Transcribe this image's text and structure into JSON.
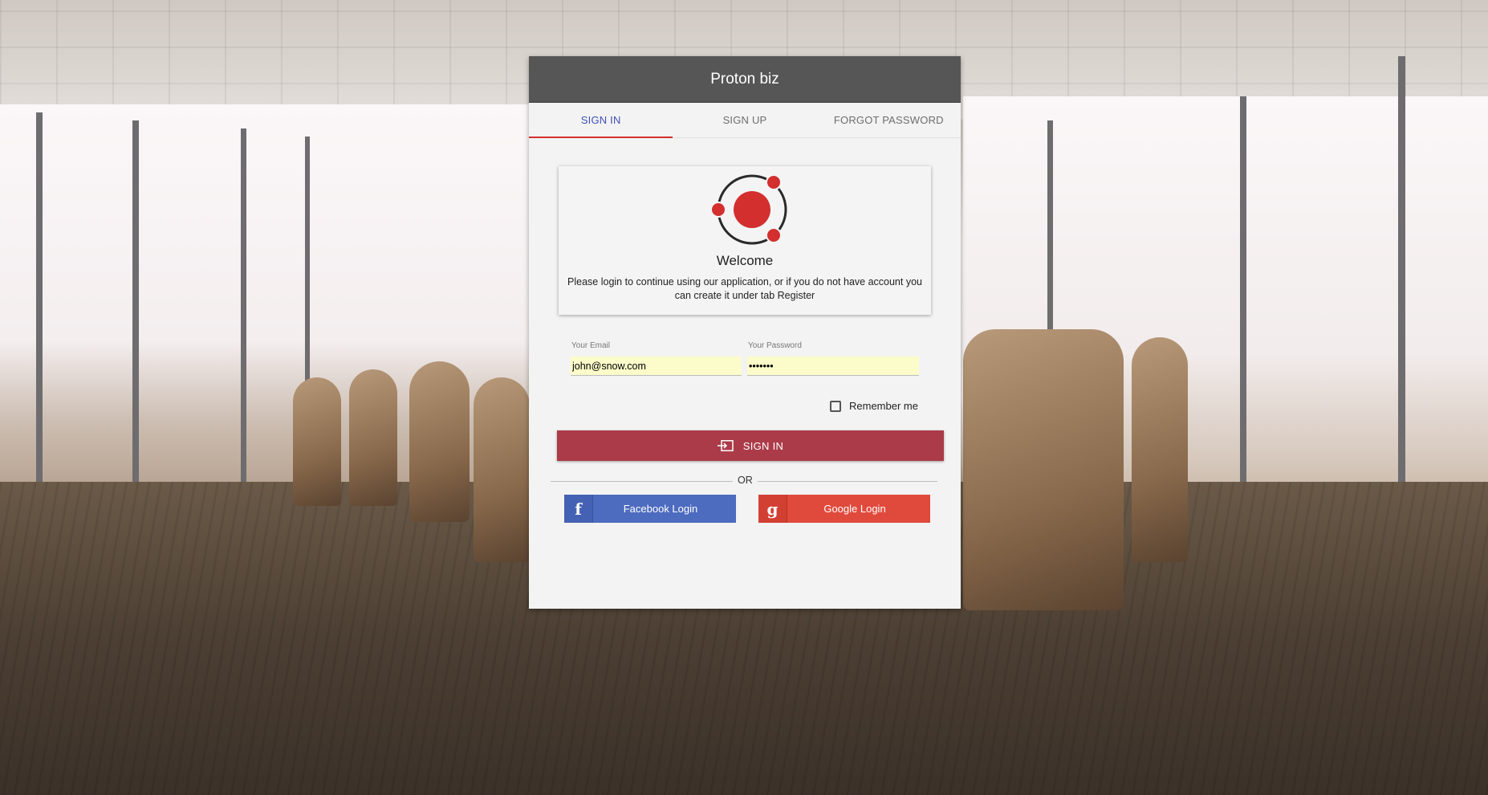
{
  "app": {
    "title": "Proton biz"
  },
  "tabs": [
    {
      "label": "SIGN IN",
      "active": true
    },
    {
      "label": "SIGN UP",
      "active": false
    },
    {
      "label": "FORGOT PASSWORD",
      "active": false
    }
  ],
  "welcome": {
    "title": "Welcome",
    "text": "Please login to continue using our application, or if you do not have account you can create it under tab Register"
  },
  "form": {
    "email_label": "Your Email",
    "email_value": "john@snow.com",
    "password_label": "Your Password",
    "password_value": "•••••••",
    "remember_label": "Remember me",
    "remember_checked": false
  },
  "actions": {
    "signin_label": "SIGN IN",
    "signin_icon": "login-icon",
    "or_text": "OR",
    "facebook_label": "Facebook Login",
    "facebook_icon": "facebook-icon",
    "google_label": "Google Login",
    "google_icon": "google-icon"
  },
  "colors": {
    "header": "#565656",
    "accent_tab": "#3f51b5",
    "tab_indicator": "#d32f2f",
    "signin_button": "#ab3b49",
    "facebook": "#4d6bbf",
    "google": "#e04a3c",
    "logo_red": "#d32f2f"
  }
}
